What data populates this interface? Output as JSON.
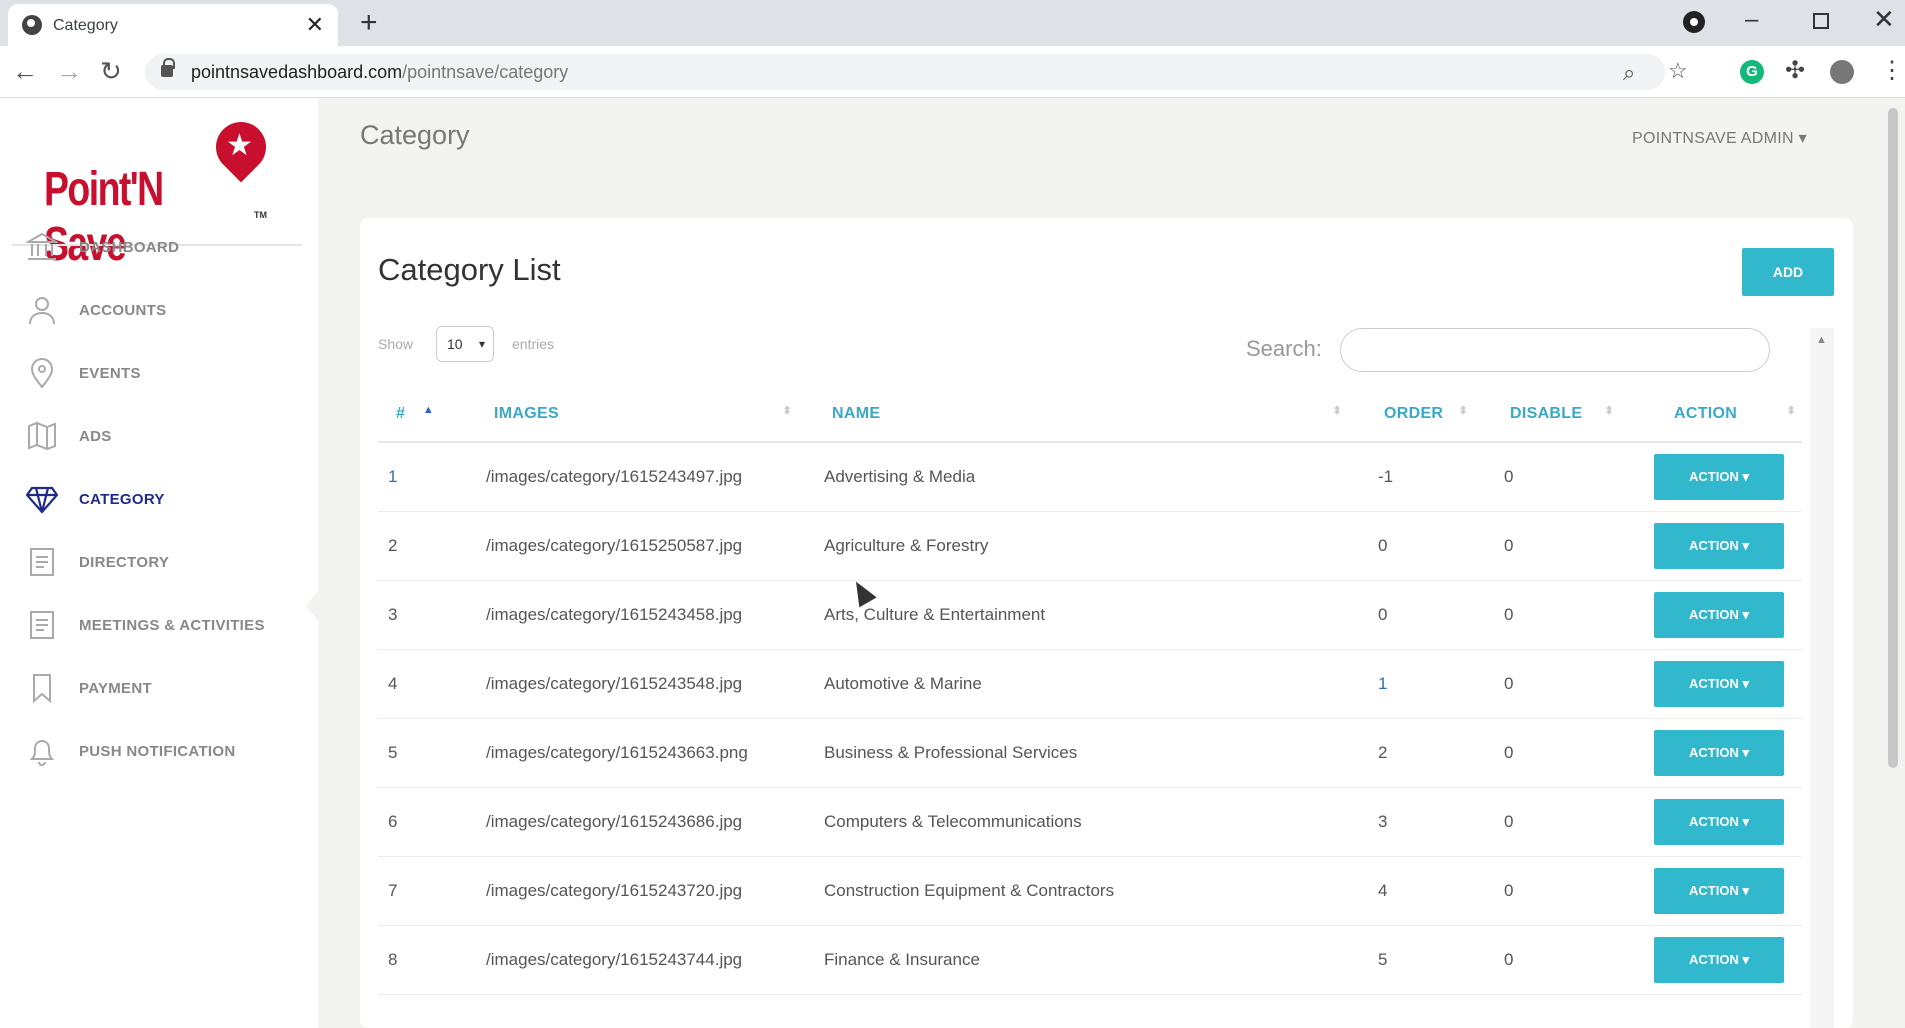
{
  "browser": {
    "tab_title": "Category",
    "url_host": "pointnsavedashboard.com",
    "url_path": "/pointnsave/category"
  },
  "brand": {
    "logo_text": "Point'N Save",
    "tm": "TM"
  },
  "sidebar": {
    "items": [
      {
        "label": "DASHBOARD",
        "icon": "bank-icon"
      },
      {
        "label": "ACCOUNTS",
        "icon": "user-icon"
      },
      {
        "label": "EVENTS",
        "icon": "map-pin-icon"
      },
      {
        "label": "ADS",
        "icon": "map-icon"
      },
      {
        "label": "CATEGORY",
        "icon": "diamond-icon",
        "active": true
      },
      {
        "label": "DIRECTORY",
        "icon": "document-icon"
      },
      {
        "label": "MEETINGS & ACTIVITIES",
        "icon": "document-icon"
      },
      {
        "label": "PAYMENT",
        "icon": "bookmark-icon"
      },
      {
        "label": "PUSH NOTIFICATION",
        "icon": "bell-icon"
      }
    ]
  },
  "header": {
    "title": "Category",
    "user": "POINTNSAVE ADMIN"
  },
  "card": {
    "title": "Category List",
    "add_label": "ADD",
    "show_label": "Show",
    "page_size": "10",
    "entries_label": "entries",
    "search_label": "Search:",
    "search_value": ""
  },
  "table": {
    "columns": [
      "#",
      "IMAGES",
      "NAME",
      "ORDER",
      "DISABLE",
      "ACTION"
    ],
    "rows": [
      {
        "num": "1",
        "image": "/images/category/1615243497.jpg",
        "name": "Advertising & Media",
        "order": "-1",
        "disable": "0",
        "action": "ACTION"
      },
      {
        "num": "2",
        "image": "/images/category/1615250587.jpg",
        "name": "Agriculture & Forestry",
        "order": "0",
        "disable": "0",
        "action": "ACTION"
      },
      {
        "num": "3",
        "image": "/images/category/1615243458.jpg",
        "name": "Arts, Culture & Entertainment",
        "order": "0",
        "disable": "0",
        "action": "ACTION"
      },
      {
        "num": "4",
        "image": "/images/category/1615243548.jpg",
        "name": "Automotive & Marine",
        "order": "1",
        "disable": "0",
        "action": "ACTION"
      },
      {
        "num": "5",
        "image": "/images/category/1615243663.png",
        "name": "Business & Professional Services",
        "order": "2",
        "disable": "0",
        "action": "ACTION"
      },
      {
        "num": "6",
        "image": "/images/category/1615243686.jpg",
        "name": "Computers & Telecommunications",
        "order": "3",
        "disable": "0",
        "action": "ACTION"
      },
      {
        "num": "7",
        "image": "/images/category/1615243720.jpg",
        "name": "Construction Equipment & Contractors",
        "order": "4",
        "disable": "0",
        "action": "ACTION"
      },
      {
        "num": "8",
        "image": "/images/category/1615243744.jpg",
        "name": "Finance & Insurance",
        "order": "5",
        "disable": "0",
        "action": "ACTION"
      }
    ]
  },
  "colors": {
    "accent": "#31b8cc",
    "brand": "#c8102e",
    "active_nav": "#1f2a8a",
    "header_text": "#3aa9c8"
  }
}
